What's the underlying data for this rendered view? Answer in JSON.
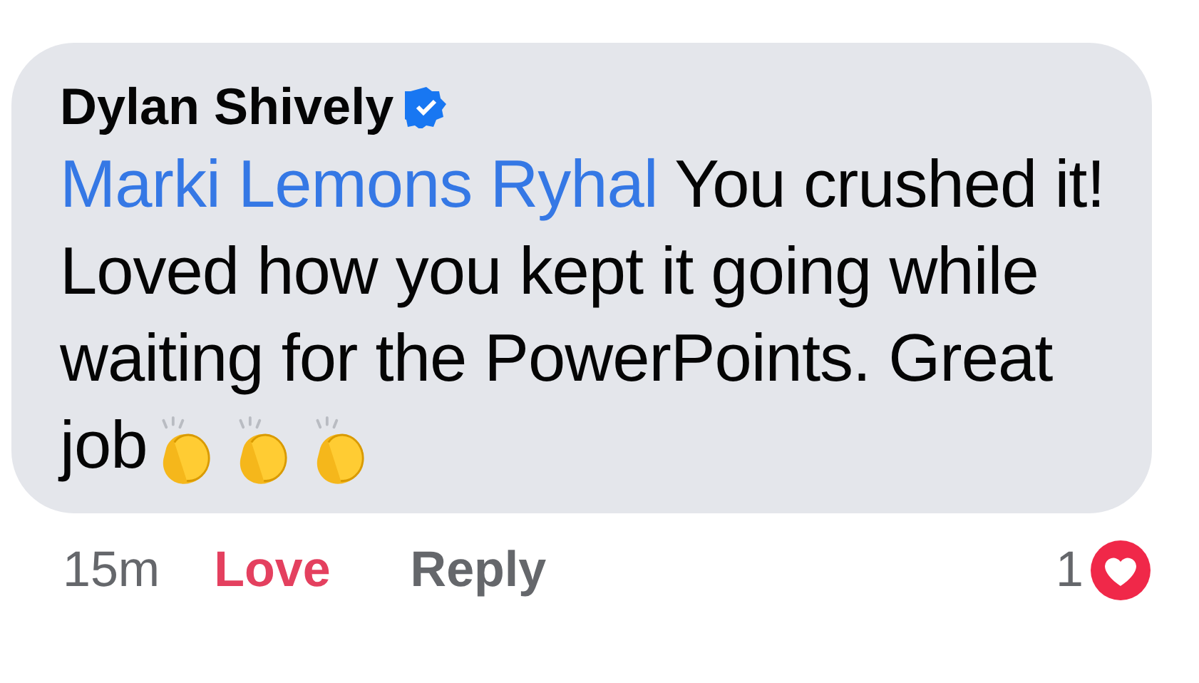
{
  "comment": {
    "author": "Dylan Shively",
    "verified": true,
    "mention": "Marki Lemons Ryhal",
    "text": "You crushed it! Loved how you kept it going while waiting for the PowerPoints. Great job",
    "emojis": [
      {
        "kind": "clap"
      },
      {
        "kind": "clap"
      },
      {
        "kind": "clap"
      }
    ]
  },
  "footer": {
    "time": "15m",
    "reaction": {
      "label": "Love",
      "selected": true
    },
    "reply": "Reply",
    "reaction_count": "1"
  }
}
